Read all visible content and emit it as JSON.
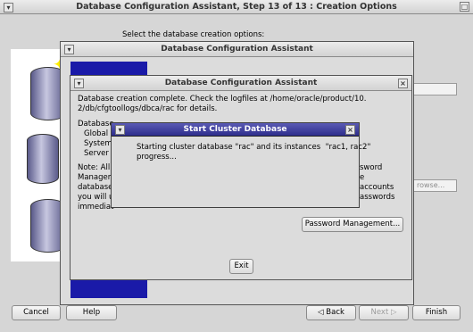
{
  "main_window": {
    "title": "Database Configuration Assistant, Step 13 of 13 : Creation Options",
    "prompt": "Select the database creation options:",
    "browse_fragment": "rowse...",
    "buttons": {
      "cancel": "Cancel",
      "help": "Help",
      "back": "Back",
      "next": "Next",
      "finish": "Finish"
    }
  },
  "dialog_back": {
    "title": "Database Configuration Assistant"
  },
  "dialog_front": {
    "title": "Database Configuration Assistant",
    "message": "Database creation complete. Check the logfiles at /home/oracle/product/10.\n2/db/cfgtoollogs/dbca/rac for details.",
    "info_lines": [
      "Database",
      "Global",
      "System",
      "Server"
    ],
    "note_left": [
      "Note: All",
      "Managem",
      "database",
      "you will u",
      "immediat"
    ],
    "note_right": [
      "sword",
      "e",
      "accounts",
      "asswords"
    ],
    "password_button": "Password Management...",
    "exit_button": "Exit"
  },
  "modal": {
    "title": "Start Cluster Database",
    "message": "Starting cluster database \"rac\" and its instances  \"rac1, rac2\"\nprogress..."
  },
  "icons": {
    "window_menu": "chevron-down-icon",
    "close": "close-icon"
  }
}
